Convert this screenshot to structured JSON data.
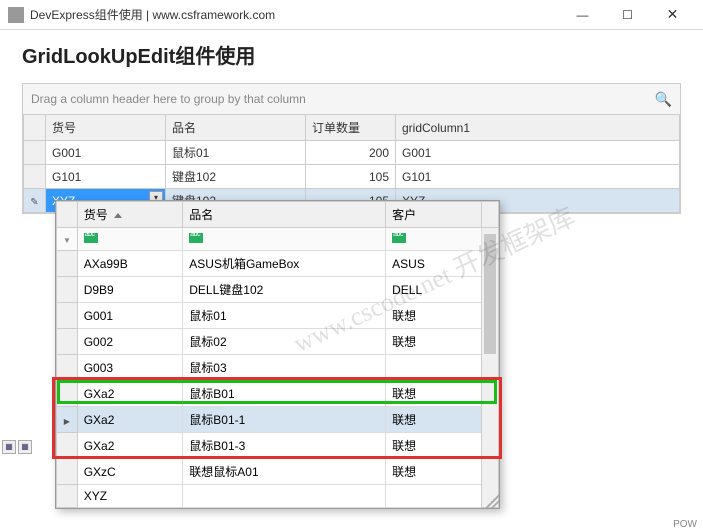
{
  "window": {
    "title": "DevExpress组件使用 | www.csframework.com"
  },
  "heading": "GridLookUpEdit组件使用",
  "groupbar": {
    "placeholder": "Drag a column header here to group by that column"
  },
  "grid": {
    "columns": [
      "货号",
      "品名",
      "订单数量",
      "gridColumn1"
    ],
    "rows": [
      {
        "c0": "G001",
        "c1": "鼠标01",
        "c2": "200",
        "c3": "G001",
        "editing": false
      },
      {
        "c0": "G101",
        "c1": "键盘102",
        "c2": "105",
        "c3": "G101",
        "editing": false
      },
      {
        "c0": "XYZ",
        "c1": "键盘102",
        "c2": "105",
        "c3": "XYZ",
        "editing": true
      }
    ]
  },
  "popup": {
    "columns": [
      "货号",
      "品名",
      "客户"
    ],
    "rows": [
      {
        "c0": "AXa99B",
        "c1": "ASUS机箱GameBox",
        "c2": "ASUS"
      },
      {
        "c0": "D9B9",
        "c1": "DELL键盘102",
        "c2": "DELL"
      },
      {
        "c0": "G001",
        "c1": "鼠标01",
        "c2": "联想"
      },
      {
        "c0": "G002",
        "c1": "鼠标02",
        "c2": "联想"
      },
      {
        "c0": "G003",
        "c1": "鼠标03",
        "c2": ""
      },
      {
        "c0": "GXa2",
        "c1": "鼠标B01",
        "c2": "联想"
      },
      {
        "c0": "GXa2",
        "c1": "鼠标B01-1",
        "c2": "联想",
        "selected": true
      },
      {
        "c0": "GXa2",
        "c1": "鼠标B01-3",
        "c2": "联想"
      },
      {
        "c0": "GXzC",
        "c1": "联想鼠标A01",
        "c2": "联想"
      },
      {
        "c0": "XYZ",
        "c1": "",
        "c2": ""
      }
    ]
  },
  "watermark": "www.cscode.net 开发框架库",
  "statusbar": "POW"
}
